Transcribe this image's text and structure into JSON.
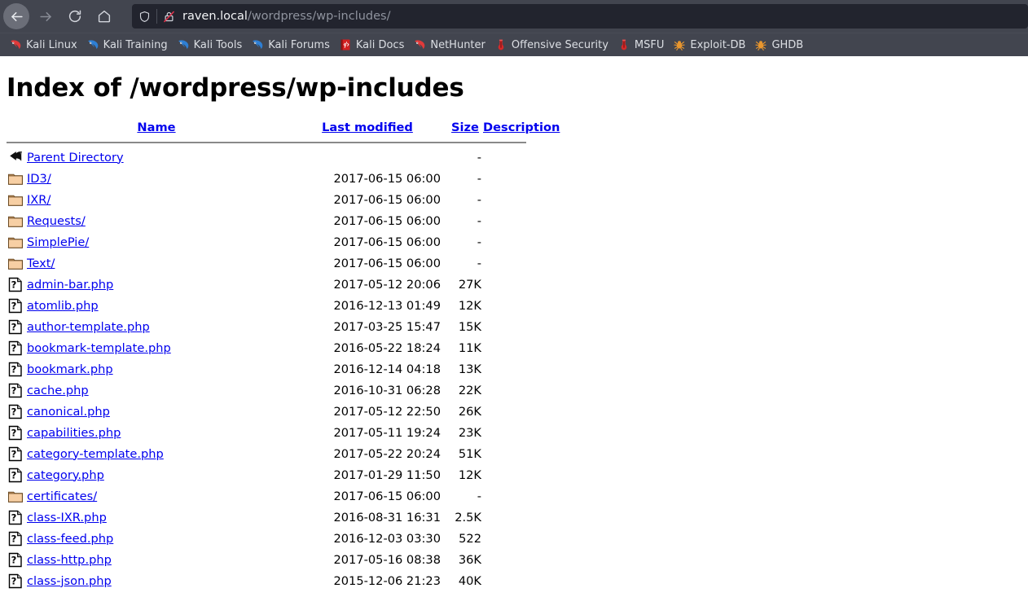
{
  "browser": {
    "nav": {
      "back_label": "Back",
      "forward_label": "Forward",
      "reload_label": "Reload",
      "home_label": "Home"
    },
    "url_bar": {
      "host": "raven.local",
      "path": "/wordpress/wp-includes/",
      "shield_icon": "shield-icon",
      "identity_icon": "broken-lock-icon"
    },
    "bookmarks": [
      {
        "label": "Kali Linux",
        "icon": "kali-dragon-red-icon"
      },
      {
        "label": "Kali Training",
        "icon": "kali-dragon-blue-icon"
      },
      {
        "label": "Kali Tools",
        "icon": "kali-dragon-blue-icon"
      },
      {
        "label": "Kali Forums",
        "icon": "kali-dragon-blue-icon"
      },
      {
        "label": "Kali Docs",
        "icon": "kali-docs-book-icon"
      },
      {
        "label": "NetHunter",
        "icon": "kali-dragon-red-icon"
      },
      {
        "label": "Offensive Security",
        "icon": "metasploit-icon"
      },
      {
        "label": "MSFU",
        "icon": "metasploit-icon"
      },
      {
        "label": "Exploit-DB",
        "icon": "spider-icon"
      },
      {
        "label": "GHDB",
        "icon": "spider-icon"
      }
    ]
  },
  "page": {
    "title": "Index of /wordpress/wp-includes",
    "columns": {
      "name": "Name",
      "last_modified": "Last modified",
      "size": "Size",
      "description": "Description"
    },
    "entries": [
      {
        "icon": "parent-directory-icon",
        "name": "Parent Directory",
        "date": "",
        "size": "-",
        "desc": ""
      },
      {
        "icon": "folder-icon",
        "name": "ID3/",
        "date": "2017-06-15 06:00",
        "size": "-",
        "desc": ""
      },
      {
        "icon": "folder-icon",
        "name": "IXR/",
        "date": "2017-06-15 06:00",
        "size": "-",
        "desc": ""
      },
      {
        "icon": "folder-icon",
        "name": "Requests/",
        "date": "2017-06-15 06:00",
        "size": "-",
        "desc": ""
      },
      {
        "icon": "folder-icon",
        "name": "SimplePie/",
        "date": "2017-06-15 06:00",
        "size": "-",
        "desc": ""
      },
      {
        "icon": "folder-icon",
        "name": "Text/",
        "date": "2017-06-15 06:00",
        "size": "-",
        "desc": ""
      },
      {
        "icon": "unknown-file-icon",
        "name": "admin-bar.php",
        "date": "2017-05-12 20:06",
        "size": "27K",
        "desc": ""
      },
      {
        "icon": "unknown-file-icon",
        "name": "atomlib.php",
        "date": "2016-12-13 01:49",
        "size": "12K",
        "desc": ""
      },
      {
        "icon": "unknown-file-icon",
        "name": "author-template.php",
        "date": "2017-03-25 15:47",
        "size": "15K",
        "desc": ""
      },
      {
        "icon": "unknown-file-icon",
        "name": "bookmark-template.php",
        "date": "2016-05-22 18:24",
        "size": "11K",
        "desc": ""
      },
      {
        "icon": "unknown-file-icon",
        "name": "bookmark.php",
        "date": "2016-12-14 04:18",
        "size": "13K",
        "desc": ""
      },
      {
        "icon": "unknown-file-icon",
        "name": "cache.php",
        "date": "2016-10-31 06:28",
        "size": "22K",
        "desc": ""
      },
      {
        "icon": "unknown-file-icon",
        "name": "canonical.php",
        "date": "2017-05-12 22:50",
        "size": "26K",
        "desc": ""
      },
      {
        "icon": "unknown-file-icon",
        "name": "capabilities.php",
        "date": "2017-05-11 19:24",
        "size": "23K",
        "desc": ""
      },
      {
        "icon": "unknown-file-icon",
        "name": "category-template.php",
        "date": "2017-05-22 20:24",
        "size": "51K",
        "desc": ""
      },
      {
        "icon": "unknown-file-icon",
        "name": "category.php",
        "date": "2017-01-29 11:50",
        "size": "12K",
        "desc": ""
      },
      {
        "icon": "folder-icon",
        "name": "certificates/",
        "date": "2017-06-15 06:00",
        "size": "-",
        "desc": ""
      },
      {
        "icon": "unknown-file-icon",
        "name": "class-IXR.php",
        "date": "2016-08-31 16:31",
        "size": "2.5K",
        "desc": ""
      },
      {
        "icon": "unknown-file-icon",
        "name": "class-feed.php",
        "date": "2016-12-03 03:30",
        "size": "522",
        "desc": ""
      },
      {
        "icon": "unknown-file-icon",
        "name": "class-http.php",
        "date": "2017-05-16 08:38",
        "size": "36K",
        "desc": ""
      },
      {
        "icon": "unknown-file-icon",
        "name": "class-json.php",
        "date": "2015-12-06 21:23",
        "size": "40K",
        "desc": ""
      }
    ]
  },
  "colors": {
    "chrome_bg": "#42454f",
    "urlbar_bg": "#22242e",
    "link": "#0000ee",
    "kali_red": "#e03a3a",
    "kali_blue": "#2e7fd4",
    "spider_orange": "#e8962e"
  }
}
